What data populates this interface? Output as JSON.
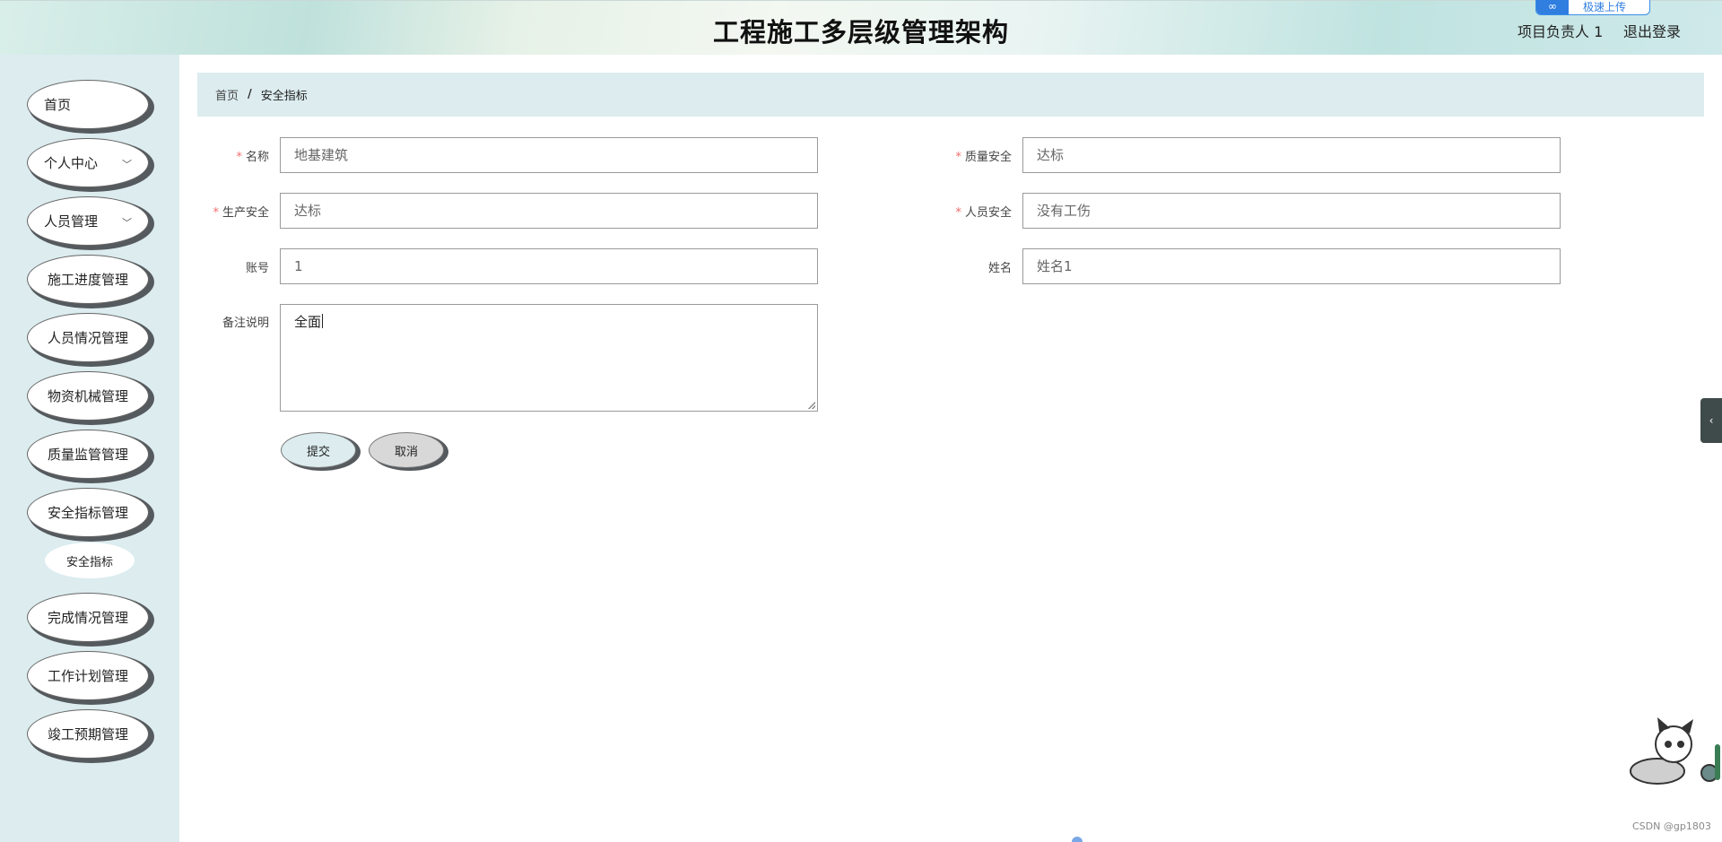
{
  "header": {
    "title": "工程施工多层级管理架构",
    "user_name": "项目负责人 1",
    "logout": "退出登录",
    "upload_button_label": "极速上传"
  },
  "sidebar": {
    "items": [
      {
        "label": "首页"
      },
      {
        "label": "个人中心",
        "has_dropdown": true
      },
      {
        "label": "人员管理",
        "has_dropdown": true
      },
      {
        "label": "施工进度管理"
      },
      {
        "label": "人员情况管理"
      },
      {
        "label": "物资机械管理"
      },
      {
        "label": "质量监管管理"
      },
      {
        "label": "安全指标管理",
        "expanded": true
      },
      {
        "label": "完成情况管理"
      },
      {
        "label": "工作计划管理"
      },
      {
        "label": "竣工预期管理"
      }
    ],
    "sub_items": {
      "safety": [
        {
          "label": "安全指标",
          "active": true
        }
      ]
    }
  },
  "breadcrumb": {
    "home": "首页",
    "separator": "/",
    "current": "安全指标"
  },
  "form": {
    "name": {
      "label": "名称",
      "required": true,
      "value": "地基建筑"
    },
    "quality_safety": {
      "label": "质量安全",
      "required": true,
      "value": "达标"
    },
    "production_safety": {
      "label": "生产安全",
      "required": true,
      "value": "达标"
    },
    "personnel_safety": {
      "label": "人员安全",
      "required": true,
      "value": "没有工伤"
    },
    "account": {
      "label": "账号",
      "required": false,
      "value": "1"
    },
    "full_name": {
      "label": "姓名",
      "required": false,
      "value": "姓名1"
    },
    "remarks": {
      "label": "备注说明",
      "required": false,
      "value": "全面"
    },
    "required_mark": "*",
    "submit_label": "提交",
    "cancel_label": "取消"
  },
  "watermark": "CSDN @gp1803",
  "colors": {
    "sidebar_bg": "#dcecef",
    "required": "#f56c6c",
    "submit_bg": "#dcecef",
    "cancel_bg": "#d8d8d8"
  }
}
